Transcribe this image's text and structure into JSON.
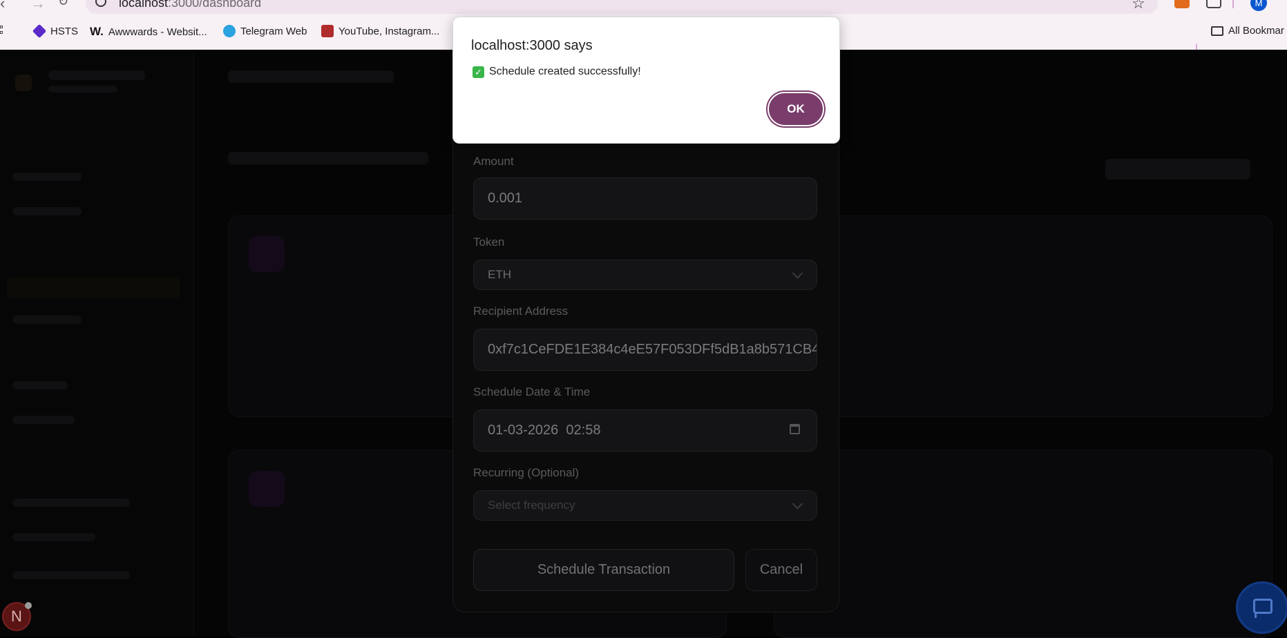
{
  "browser": {
    "url_host": "localhost",
    "url_path": ":3000/dashboard",
    "bookmarks": [
      {
        "label": "HSTS",
        "icon": "purple-cube-icon"
      },
      {
        "label": "Awwwards - Websit...",
        "icon": "awwwards-w-icon"
      },
      {
        "label": "Telegram Web",
        "icon": "telegram-icon"
      },
      {
        "label": "YouTube, Instagram...",
        "icon": "bar-chart-icon"
      }
    ],
    "all_bookmarks_label": "All Bookmar",
    "profile_initial": "M"
  },
  "modal": {
    "amount_label": "Amount",
    "amount_value": "0.001",
    "token_label": "Token",
    "token_value": "ETH",
    "recipient_label": "Recipient Address",
    "recipient_value": "0xf7c1CeFDE1E384c4eE57F053DFf5dB1a8b571CB4",
    "schedule_label": "Schedule Date & Time",
    "schedule_value": "01-03-2026  02:58",
    "recurring_label": "Recurring (Optional)",
    "recurring_placeholder": "Select frequency",
    "submit_label": "Schedule Transaction",
    "cancel_label": "Cancel"
  },
  "alert": {
    "title": "localhost:3000 says",
    "message": "Schedule created successfully!",
    "ok_label": "OK",
    "accent": "#7a3d6b"
  },
  "floating": {
    "avatar_letter": "N"
  }
}
